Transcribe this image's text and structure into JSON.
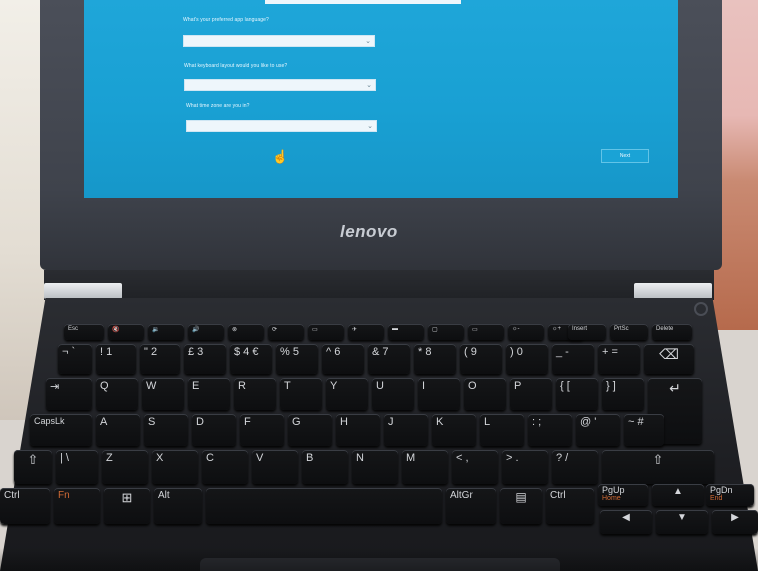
{
  "screen": {
    "questions": [
      {
        "question": "What's your preferred app language?",
        "value": ""
      },
      {
        "question": "What keyboard layout would you like to use?",
        "value": ""
      },
      {
        "question": "What time zone are you in?",
        "value": ""
      }
    ],
    "next_button": "Next",
    "ease_of_access_icon": "ease-of-access-icon"
  },
  "laptop": {
    "brand_logo": "lenovo"
  },
  "keyboard": {
    "fn_row": [
      "Esc",
      "",
      "",
      "",
      "",
      "",
      "",
      "",
      "",
      "",
      "",
      "",
      "",
      "",
      "Insert",
      "PrtSc",
      "Delete"
    ],
    "number_row": [
      "¬ `",
      "! 1",
      "\" 2",
      "£ 3",
      "$ 4 €",
      "% 5",
      "^ 6",
      "& 7",
      "* 8",
      "( 9",
      ") 0",
      "_ -",
      "+ ="
    ],
    "qwerty_row": [
      "Q",
      "W",
      "E",
      "R",
      "T",
      "Y",
      "U",
      "I",
      "O",
      "P",
      "{ [",
      "} ]"
    ],
    "home_row": [
      "CapsLk",
      "A",
      "S",
      "D",
      "F",
      "G",
      "H",
      "J",
      "K",
      "L",
      ": ;",
      "@ '",
      "~ #"
    ],
    "shift_row": [
      "| \\",
      "Z",
      "X",
      "C",
      "V",
      "B",
      "N",
      "M",
      "< ,",
      "> .",
      "? /"
    ],
    "bottom_row": {
      "ctrl_left": "Ctrl",
      "fn": "Fn",
      "alt": "Alt",
      "altgr": "AltGr",
      "ctrl_right": "Ctrl",
      "pgup": "PgUp",
      "pgup_sub": "Home",
      "pgdn": "PgDn",
      "pgdn_sub": "End"
    }
  }
}
